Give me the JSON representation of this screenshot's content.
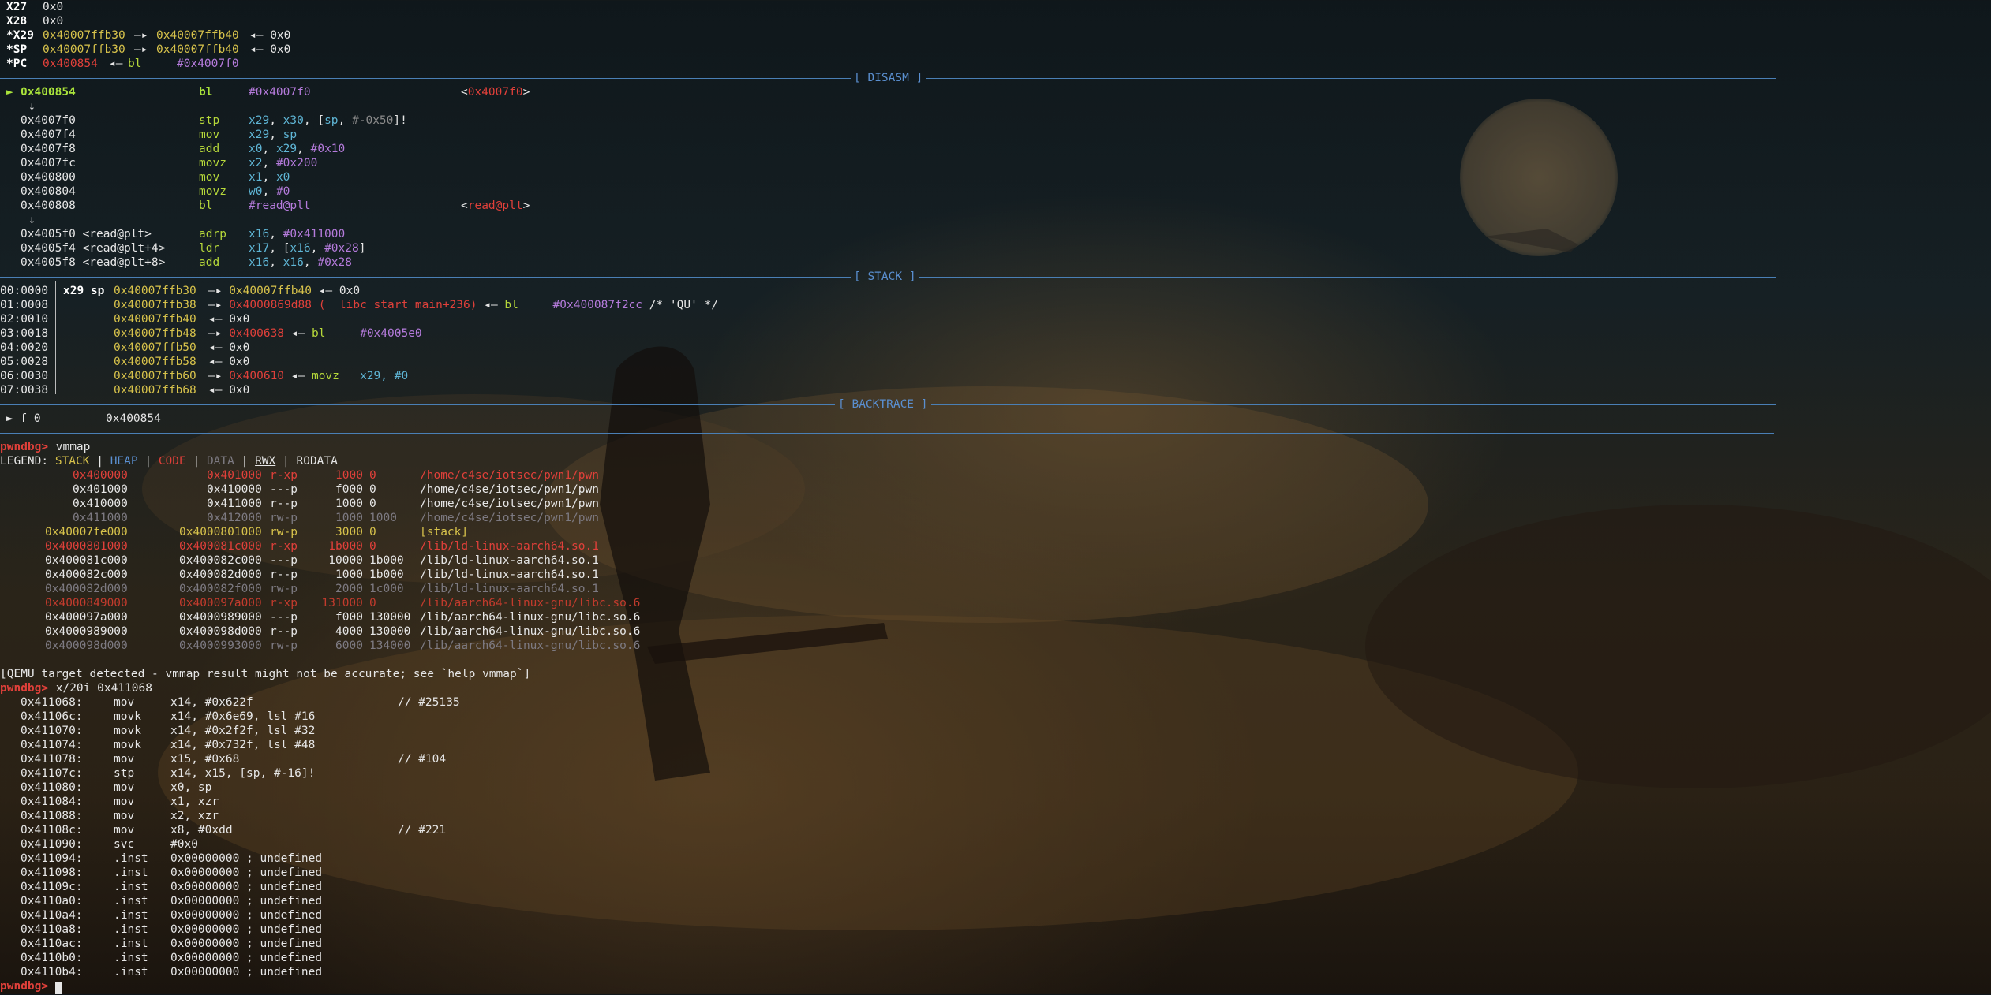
{
  "registers": [
    {
      "name": "X27",
      "value": "0x0",
      "changed": false
    },
    {
      "name": "X28",
      "value": "0x0",
      "changed": false
    },
    {
      "name": "*X29",
      "addr": "0x40007ffb30",
      "arrow": "—▸",
      "target": "0x40007ffb40",
      "arrow2": "◂—",
      "tail": "0x0"
    },
    {
      "name": "*SP",
      "addr": "0x40007ffb30",
      "arrow": "—▸",
      "target": "0x40007ffb40",
      "arrow2": "◂—",
      "tail": "0x0"
    },
    {
      "name": "*PC",
      "addr": "0x400854",
      "arrow2": "◂—",
      "op": "bl",
      "operand": "#0x4007f0"
    }
  ],
  "sections": {
    "disasm": "[ DISASM ]",
    "stack": "[ STACK ]",
    "backtrace": "[ BACKTRACE ]"
  },
  "disasm": [
    {
      "marker": "►",
      "addr": "0x400854",
      "mnemonic": "bl",
      "ops": "#0x4007f0",
      "target": "<0x4007f0>",
      "current": true
    },
    {
      "arrow": "↓"
    },
    {
      "addr": "0x4007f0",
      "mnemonic": "stp",
      "ops": "x29, x30, [sp, #-0x50]!"
    },
    {
      "addr": "0x4007f4",
      "mnemonic": "mov",
      "ops": "x29, sp"
    },
    {
      "addr": "0x4007f8",
      "mnemonic": "add",
      "ops": "x0, x29, #0x10"
    },
    {
      "addr": "0x4007fc",
      "mnemonic": "movz",
      "ops": "x2, #0x200"
    },
    {
      "addr": "0x400800",
      "mnemonic": "mov",
      "ops": "x1, x0"
    },
    {
      "addr": "0x400804",
      "mnemonic": "movz",
      "ops": "w0, #0"
    },
    {
      "addr": "0x400808",
      "mnemonic": "bl",
      "ops": "#read@plt",
      "target": "<read@plt>"
    },
    {
      "arrow": "↓"
    },
    {
      "addr": "0x4005f0 <read@plt>",
      "mnemonic": "adrp",
      "ops": "x16, #0x411000"
    },
    {
      "addr": "0x4005f4 <read@plt+4>",
      "mnemonic": "ldr",
      "ops": "x17, [x16, #0x28]"
    },
    {
      "addr": "0x4005f8 <read@plt+8>",
      "mnemonic": "add",
      "ops": "x16, x16, #0x28"
    }
  ],
  "stack": [
    {
      "idx": "00:0000",
      "regs": "x29 sp",
      "addr": "0x40007ffb30",
      "rest": [
        [
          "—▸ ",
          "w"
        ],
        [
          "0x40007ffb40",
          "y"
        ],
        [
          " ◂— 0x0",
          "w"
        ]
      ]
    },
    {
      "idx": "01:0008",
      "regs": "",
      "addr": "0x40007ffb38",
      "rest": [
        [
          "—▸ ",
          "w"
        ],
        [
          "0x4000869d88 (__libc_start_main+236)",
          "r"
        ],
        [
          " ◂— ",
          "w"
        ],
        [
          "bl",
          "g"
        ],
        [
          "     #0x400087f2cc",
          "m"
        ],
        [
          " /* 'QU' */",
          "w"
        ]
      ]
    },
    {
      "idx": "02:0010",
      "regs": "",
      "addr": "0x40007ffb40",
      "rest": [
        [
          "◂— 0x0",
          "w"
        ]
      ]
    },
    {
      "idx": "03:0018",
      "regs": "",
      "addr": "0x40007ffb48",
      "rest": [
        [
          "—▸ ",
          "w"
        ],
        [
          "0x400638",
          "r"
        ],
        [
          " ◂— ",
          "w"
        ],
        [
          "bl",
          "g"
        ],
        [
          "     #0x4005e0",
          "m"
        ]
      ]
    },
    {
      "idx": "04:0020",
      "regs": "",
      "addr": "0x40007ffb50",
      "rest": [
        [
          "◂— 0x0",
          "w"
        ]
      ]
    },
    {
      "idx": "05:0028",
      "regs": "",
      "addr": "0x40007ffb58",
      "rest": [
        [
          "◂— 0x0",
          "w"
        ]
      ]
    },
    {
      "idx": "06:0030",
      "regs": "",
      "addr": "0x40007ffb60",
      "rest": [
        [
          "—▸ ",
          "w"
        ],
        [
          "0x400610",
          "r"
        ],
        [
          " ◂— ",
          "w"
        ],
        [
          "movz",
          "g"
        ],
        [
          "   x29, #0",
          "cy"
        ]
      ]
    },
    {
      "idx": "07:0038",
      "regs": "",
      "addr": "0x40007ffb68",
      "rest": [
        [
          "◂— 0x0",
          "w"
        ]
      ]
    }
  ],
  "backtrace": [
    {
      "marker": "►",
      "frame": "f 0",
      "addr": "0x400854"
    }
  ],
  "prompt": "pwndbg>",
  "vmmap_cmd": "vmmap",
  "legend": {
    "label": "LEGEND:",
    "stack": "STACK",
    "heap": "HEAP",
    "code": "CODE",
    "data": "DATA",
    "rwx": "RWX",
    "rodata": "RODATA",
    "sep": " | "
  },
  "vmmap": [
    {
      "start": "0x400000",
      "end": "0x401000",
      "perm": "r-xp",
      "size": "1000",
      "off": "0",
      "file": "/home/c4se/iotsec/pwn1/pwn",
      "cls": "r"
    },
    {
      "start": "0x401000",
      "end": "0x410000",
      "perm": "---p",
      "size": "f000",
      "off": "0",
      "file": "/home/c4se/iotsec/pwn1/pwn",
      "cls": "w"
    },
    {
      "start": "0x410000",
      "end": "0x411000",
      "perm": "r--p",
      "size": "1000",
      "off": "0",
      "file": "/home/c4se/iotsec/pwn1/pwn",
      "cls": "w"
    },
    {
      "start": "0x411000",
      "end": "0x412000",
      "perm": "rw-p",
      "size": "1000",
      "off": "1000",
      "file": "/home/c4se/iotsec/pwn1/pwn",
      "cls": "fa"
    },
    {
      "start": "0x40007fe000",
      "end": "0x4000801000",
      "perm": "rw-p",
      "size": "3000",
      "off": "0",
      "file": "[stack]",
      "cls": "y"
    },
    {
      "start": "0x4000801000",
      "end": "0x400081c000",
      "perm": "r-xp",
      "size": "1b000",
      "off": "0",
      "file": "/lib/ld-linux-aarch64.so.1",
      "cls": "r"
    },
    {
      "start": "0x400081c000",
      "end": "0x400082c000",
      "perm": "---p",
      "size": "10000",
      "off": "1b000",
      "file": "/lib/ld-linux-aarch64.so.1",
      "cls": "w"
    },
    {
      "start": "0x400082c000",
      "end": "0x400082d000",
      "perm": "r--p",
      "size": "1000",
      "off": "1b000",
      "file": "/lib/ld-linux-aarch64.so.1",
      "cls": "w"
    },
    {
      "start": "0x400082d000",
      "end": "0x400082f000",
      "perm": "rw-p",
      "size": "2000",
      "off": "1c000",
      "file": "/lib/ld-linux-aarch64.so.1",
      "cls": "fa"
    },
    {
      "start": "0x4000849000",
      "end": "0x400097a000",
      "perm": "r-xp",
      "size": "131000",
      "off": "0",
      "file": "/lib/aarch64-linux-gnu/libc.so.6",
      "cls": "rd"
    },
    {
      "start": "0x400097a000",
      "end": "0x4000989000",
      "perm": "---p",
      "size": "f000",
      "off": "130000",
      "file": "/lib/aarch64-linux-gnu/libc.so.6",
      "cls": "w"
    },
    {
      "start": "0x4000989000",
      "end": "0x400098d000",
      "perm": "r--p",
      "size": "4000",
      "off": "130000",
      "file": "/lib/aarch64-linux-gnu/libc.so.6",
      "cls": "w"
    },
    {
      "start": "0x400098d000",
      "end": "0x4000993000",
      "perm": "rw-p",
      "size": "6000",
      "off": "134000",
      "file": "/lib/aarch64-linux-gnu/libc.so.6",
      "cls": "fa"
    }
  ],
  "qemu_note": "[QEMU target detected - vmmap result might not be accurate; see `help vmmap`]",
  "x_cmd": "x/20i 0x411068",
  "xdump": [
    {
      "addr": "0x411068:",
      "mn": "mov",
      "ops": "x14, #0x622f",
      "cm": "// #25135"
    },
    {
      "addr": "0x41106c:",
      "mn": "movk",
      "ops": "x14, #0x6e69, lsl #16",
      "cm": ""
    },
    {
      "addr": "0x411070:",
      "mn": "movk",
      "ops": "x14, #0x2f2f, lsl #32",
      "cm": ""
    },
    {
      "addr": "0x411074:",
      "mn": "movk",
      "ops": "x14, #0x732f, lsl #48",
      "cm": ""
    },
    {
      "addr": "0x411078:",
      "mn": "mov",
      "ops": "x15, #0x68",
      "cm": "// #104"
    },
    {
      "addr": "0x41107c:",
      "mn": "stp",
      "ops": "x14, x15, [sp, #-16]!",
      "cm": ""
    },
    {
      "addr": "0x411080:",
      "mn": "mov",
      "ops": "x0, sp",
      "cm": ""
    },
    {
      "addr": "0x411084:",
      "mn": "mov",
      "ops": "x1, xzr",
      "cm": ""
    },
    {
      "addr": "0x411088:",
      "mn": "mov",
      "ops": "x2, xzr",
      "cm": ""
    },
    {
      "addr": "0x41108c:",
      "mn": "mov",
      "ops": "x8, #0xdd",
      "cm": "// #221"
    },
    {
      "addr": "0x411090:",
      "mn": "svc",
      "ops": "#0x0",
      "cm": ""
    },
    {
      "addr": "0x411094:",
      "mn": ".inst",
      "ops": "0x00000000 ; undefined",
      "cm": ""
    },
    {
      "addr": "0x411098:",
      "mn": ".inst",
      "ops": "0x00000000 ; undefined",
      "cm": ""
    },
    {
      "addr": "0x41109c:",
      "mn": ".inst",
      "ops": "0x00000000 ; undefined",
      "cm": ""
    },
    {
      "addr": "0x4110a0:",
      "mn": ".inst",
      "ops": "0x00000000 ; undefined",
      "cm": ""
    },
    {
      "addr": "0x4110a4:",
      "mn": ".inst",
      "ops": "0x00000000 ; undefined",
      "cm": ""
    },
    {
      "addr": "0x4110a8:",
      "mn": ".inst",
      "ops": "0x00000000 ; undefined",
      "cm": ""
    },
    {
      "addr": "0x4110ac:",
      "mn": ".inst",
      "ops": "0x00000000 ; undefined",
      "cm": ""
    },
    {
      "addr": "0x4110b0:",
      "mn": ".inst",
      "ops": "0x00000000 ; undefined",
      "cm": ""
    },
    {
      "addr": "0x4110b4:",
      "mn": ".inst",
      "ops": "0x00000000 ; undefined",
      "cm": ""
    }
  ]
}
